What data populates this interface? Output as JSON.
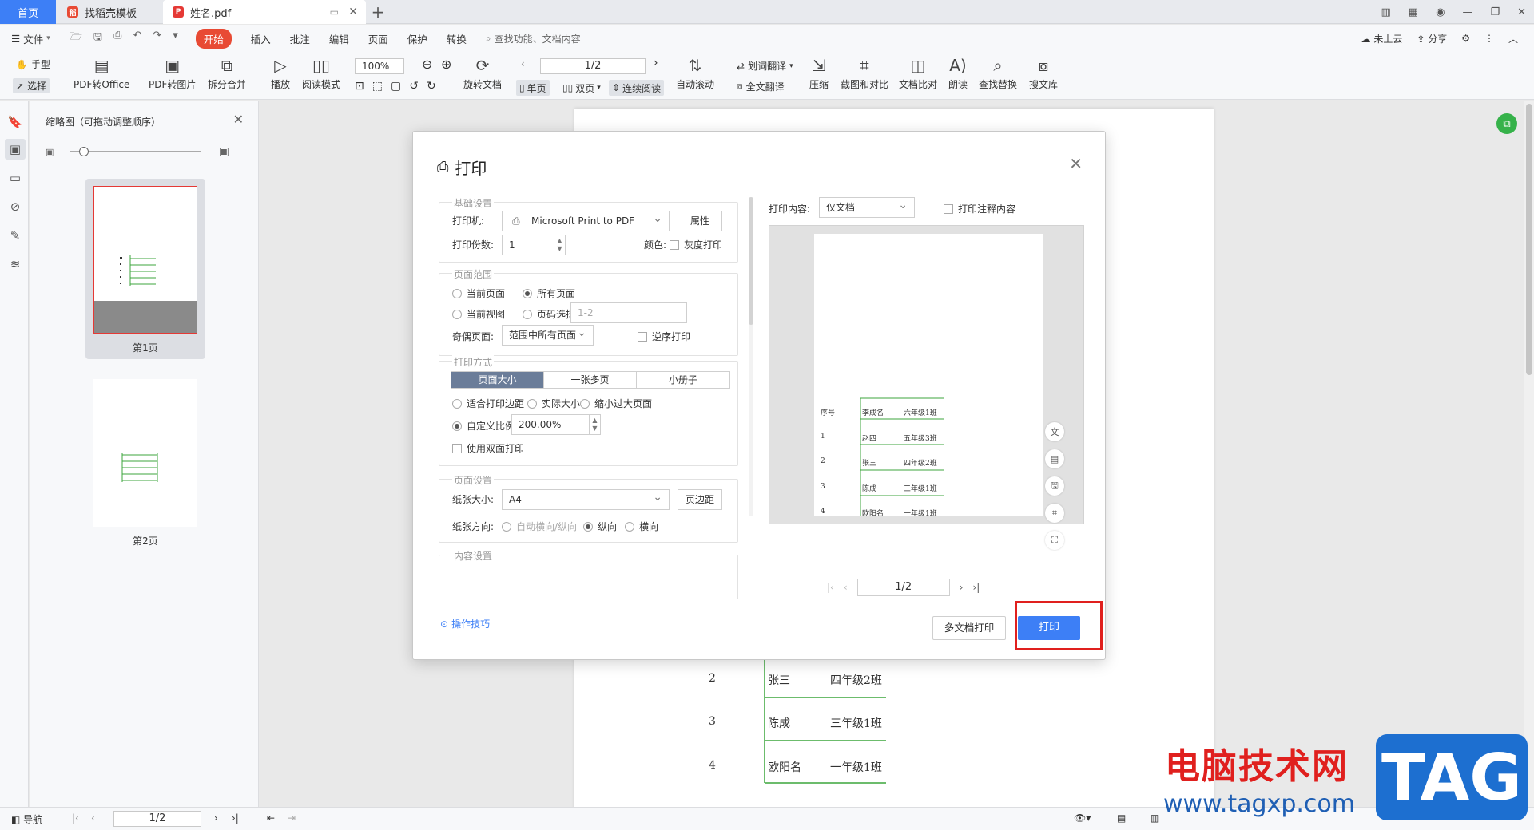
{
  "tabs": {
    "home": "首页",
    "template": "找稻壳模板",
    "doc": "姓名.pdf"
  },
  "menu": {
    "file": "文件",
    "items": [
      "开始",
      "插入",
      "批注",
      "编辑",
      "页面",
      "保护",
      "转换"
    ],
    "search_placeholder": "查找功能、文档内容",
    "cloud": "未上云",
    "share": "分享"
  },
  "toolbar": {
    "hand": "手型",
    "select": "选择",
    "pdf_to_office": "PDF转Office",
    "pdf_to_image": "PDF转图片",
    "split_merge": "拆分合并",
    "play": "播放",
    "read_mode": "阅读模式",
    "zoom": "100%",
    "rotate_doc": "旋转文档",
    "page": "1/2",
    "single": "单页",
    "double": "双页",
    "continuous": "连续阅读",
    "auto_scroll": "自动滚动",
    "word_translate": "划词翻译",
    "full_translate": "全文翻译",
    "compress": "压缩",
    "screenshot_compare": "截图和对比",
    "doc_compare": "文档比对",
    "read_aloud": "朗读",
    "find_replace": "查找替换",
    "search_lib": "搜文库"
  },
  "thumbnails": {
    "title": "缩略图（可拖动调整顺序）",
    "pages": [
      "第1页",
      "第2页"
    ]
  },
  "document": {
    "rows": [
      {
        "no": "2",
        "name": "张三",
        "class": "四年级2班"
      },
      {
        "no": "3",
        "name": "陈成",
        "class": "三年级1班"
      },
      {
        "no": "4",
        "name": "欧阳名",
        "class": "一年级1班"
      }
    ]
  },
  "dialog": {
    "title": "打印",
    "basic": {
      "group": "基础设置",
      "printer_label": "打印机:",
      "printer": "Microsoft Print to PDF",
      "properties": "属性",
      "copies_label": "打印份数:",
      "copies": "1",
      "color_label": "颜色:",
      "grayscale": "灰度打印"
    },
    "range": {
      "group": "页面范围",
      "current_page": "当前页面",
      "all_pages": "所有页面",
      "current_view": "当前视图",
      "page_select": "页码选择:",
      "page_select_placeholder": "1-2",
      "odd_even_label": "奇偶页面:",
      "odd_even": "范围中所有页面",
      "reverse": "逆序打印"
    },
    "mode": {
      "group": "打印方式",
      "tabs": [
        "页面大小",
        "一张多页",
        "小册子"
      ],
      "fit_margin": "适合打印边距",
      "actual_size": "实际大小",
      "shrink": "缩小过大页面",
      "custom_scale": "自定义比例",
      "scale": "200.00%",
      "duplex": "使用双面打印"
    },
    "page_setup": {
      "group": "页面设置",
      "paper_label": "纸张大小:",
      "paper": "A4",
      "margins": "页边距",
      "orient_label": "纸张方向:",
      "auto": "自动横向/纵向",
      "portrait": "纵向",
      "landscape": "横向"
    },
    "content_group": "内容设置",
    "print_content_label": "打印内容:",
    "print_content": "仅文档",
    "print_annotations": "打印注释内容",
    "preview": {
      "header": {
        "no": "序号",
        "name": "李成名",
        "class": "六年级1班"
      },
      "rows": [
        {
          "no": "1",
          "name": "赵四",
          "class": "五年级3班"
        },
        {
          "no": "2",
          "name": "张三",
          "class": "四年级2班"
        },
        {
          "no": "3",
          "name": "陈成",
          "class": "三年级1班"
        },
        {
          "no": "4",
          "name": "欧阳名",
          "class": "一年级1班"
        }
      ],
      "page": "1/2"
    },
    "tips": "操作技巧",
    "multi_print": "多文档打印",
    "print": "打印"
  },
  "status": {
    "nav": "导航",
    "page": "1/2"
  },
  "watermark": {
    "cn": "电脑技术网",
    "url": "www.tagxp.com",
    "tag": "TAG"
  }
}
